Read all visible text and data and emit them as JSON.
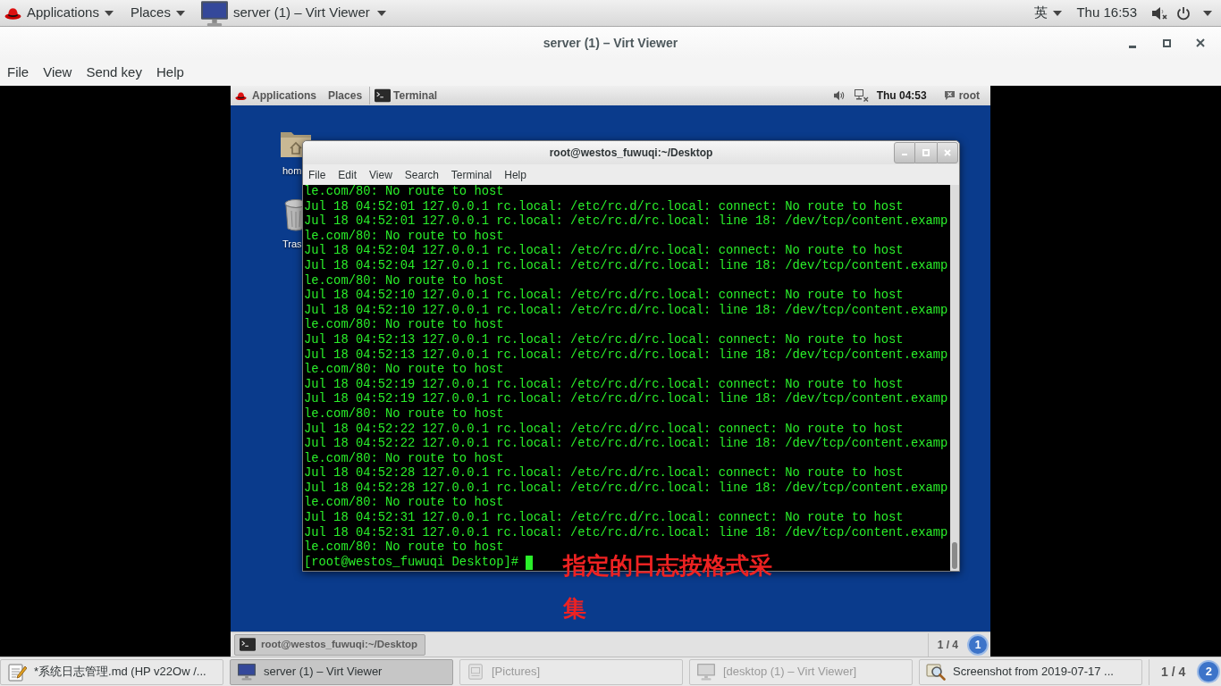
{
  "top_bar": {
    "applications": "Applications",
    "places": "Places",
    "active_window": "server (1) – Virt Viewer",
    "input_method": "英",
    "clock": "Thu 16:53"
  },
  "window": {
    "title": "server (1) – Virt Viewer",
    "menu": [
      "File",
      "View",
      "Send key",
      "Help"
    ]
  },
  "guest": {
    "top_bar": {
      "applications": "Applications",
      "places": "Places",
      "active_window": "Terminal",
      "clock": "Thu 04:53",
      "user": "root"
    },
    "desktop_icons": [
      {
        "kind": "folder",
        "label": "hom"
      },
      {
        "kind": "trash",
        "label": "Tras"
      }
    ],
    "terminal": {
      "title": "root@westos_fuwuqi:~/Desktop",
      "menu": [
        "File",
        "Edit",
        "View",
        "Search",
        "Terminal",
        "Help"
      ],
      "lines": [
        "le.com/80: No route to host",
        "Jul 18 04:52:01 127.0.0.1 rc.local: /etc/rc.d/rc.local: connect: No route to host",
        "Jul 18 04:52:01 127.0.0.1 rc.local: /etc/rc.d/rc.local: line 18: /dev/tcp/content.examp",
        "le.com/80: No route to host",
        "Jul 18 04:52:04 127.0.0.1 rc.local: /etc/rc.d/rc.local: connect: No route to host",
        "Jul 18 04:52:04 127.0.0.1 rc.local: /etc/rc.d/rc.local: line 18: /dev/tcp/content.examp",
        "le.com/80: No route to host",
        "Jul 18 04:52:10 127.0.0.1 rc.local: /etc/rc.d/rc.local: connect: No route to host",
        "Jul 18 04:52:10 127.0.0.1 rc.local: /etc/rc.d/rc.local: line 18: /dev/tcp/content.examp",
        "le.com/80: No route to host",
        "Jul 18 04:52:13 127.0.0.1 rc.local: /etc/rc.d/rc.local: connect: No route to host",
        "Jul 18 04:52:13 127.0.0.1 rc.local: /etc/rc.d/rc.local: line 18: /dev/tcp/content.examp",
        "le.com/80: No route to host",
        "Jul 18 04:52:19 127.0.0.1 rc.local: /etc/rc.d/rc.local: connect: No route to host",
        "Jul 18 04:52:19 127.0.0.1 rc.local: /etc/rc.d/rc.local: line 18: /dev/tcp/content.examp",
        "le.com/80: No route to host",
        "Jul 18 04:52:22 127.0.0.1 rc.local: /etc/rc.d/rc.local: connect: No route to host",
        "Jul 18 04:52:22 127.0.0.1 rc.local: /etc/rc.d/rc.local: line 18: /dev/tcp/content.examp",
        "le.com/80: No route to host",
        "Jul 18 04:52:28 127.0.0.1 rc.local: /etc/rc.d/rc.local: connect: No route to host",
        "Jul 18 04:52:28 127.0.0.1 rc.local: /etc/rc.d/rc.local: line 18: /dev/tcp/content.examp",
        "le.com/80: No route to host",
        "Jul 18 04:52:31 127.0.0.1 rc.local: /etc/rc.d/rc.local: connect: No route to host",
        "Jul 18 04:52:31 127.0.0.1 rc.local: /etc/rc.d/rc.local: line 18: /dev/tcp/content.examp",
        "le.com/80: No route to host"
      ],
      "prompt": "[root@westos_fuwuqi Desktop]#",
      "cursor": true
    },
    "annotation": "指定的日志按格式采集",
    "taskbar": {
      "windows": [
        {
          "label": "root@westos_fuwuqi:~/Desktop",
          "selected": true
        }
      ],
      "workspace": "1 / 4",
      "notifications": "1"
    }
  },
  "taskbar": {
    "windows": [
      {
        "kind": "editor",
        "label": "*系统日志管理.md (HP v22Ow /...",
        "selected": false,
        "minimized": false
      },
      {
        "kind": "viewer",
        "label": "server (1) – Virt Viewer",
        "selected": true,
        "minimized": false
      },
      {
        "kind": "pictures",
        "label": "[Pictures]",
        "selected": false,
        "minimized": true
      },
      {
        "kind": "viewer",
        "label": "[desktop (1) – Virt Viewer]",
        "selected": false,
        "minimized": true
      },
      {
        "kind": "screenshot",
        "label": "Screenshot from 2019-07-17 ...",
        "selected": false,
        "minimized": false
      }
    ],
    "workspace": "1 / 4",
    "notifications": "2"
  }
}
